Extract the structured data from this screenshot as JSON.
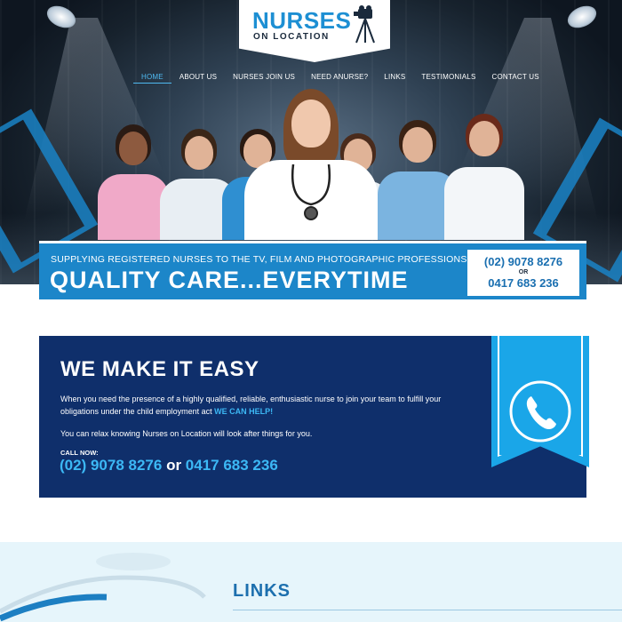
{
  "logo": {
    "line1": "NURSES",
    "line2": "ON LOCATION",
    "icon": "camera-on-tripod-icon"
  },
  "nav": {
    "items": [
      {
        "label": "HOME",
        "active": true
      },
      {
        "label": "ABOUT US",
        "active": false
      },
      {
        "label": "NURSES JOIN US",
        "active": false
      },
      {
        "label": "NEED ANURSE?",
        "active": false
      },
      {
        "label": "LINKS",
        "active": false
      },
      {
        "label": "TESTIMONIALS",
        "active": false
      },
      {
        "label": "CONTACT US",
        "active": false
      }
    ]
  },
  "banner": {
    "tagline_small": "SUPPLYING REGISTERED NURSES TO THE TV, FILM AND PHOTOGRAPHIC PROFESSIONS",
    "tagline_big": "QUALITY CARE...EVERYTIME",
    "phone1": "(02) 9078 8276",
    "or": "OR",
    "phone2": "0417 683 236"
  },
  "easy": {
    "heading": "WE MAKE IT EASY",
    "para1": "When you need the presence of a highly qualified, reliable, enthusiastic nurse to join your team to fulfill your obligations under the child employment act",
    "para1_highlight": "WE CAN HELP!",
    "para2": "You can relax knowing Nurses on Location will look after things for you.",
    "call_now": "CALL NOW:",
    "phone1": "(02) 9078 8276",
    "or": "or",
    "phone2": "0417 683 236",
    "icon": "phone-icon"
  },
  "links": {
    "heading": "LINKS"
  },
  "colors": {
    "brand_blue": "#1c86c9",
    "dark_navy": "#0f2f6b",
    "accent_cyan": "#3cb8f5",
    "ribbon": "#1aa6e8"
  }
}
